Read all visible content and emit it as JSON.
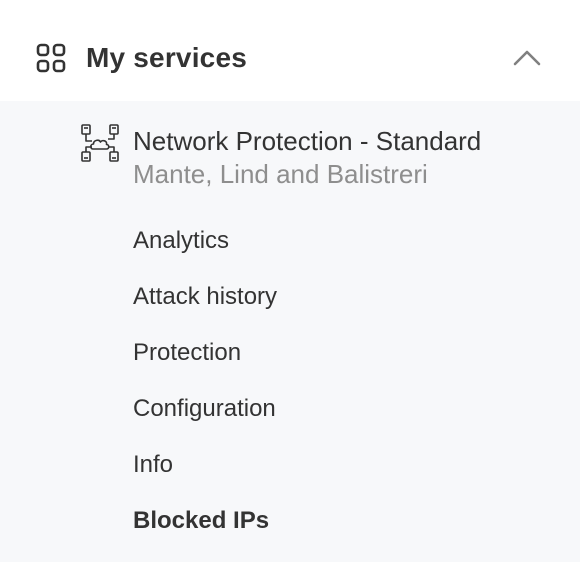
{
  "header": {
    "title": "My services",
    "icon": "grid-icon",
    "toggle_icon": "chevron-up-icon"
  },
  "service": {
    "icon": "network-cloud-icon",
    "name": "Network Protection - Standard",
    "company": "Mante, Lind and Balistreri"
  },
  "menu": {
    "items": [
      {
        "label": "Analytics",
        "active": false
      },
      {
        "label": "Attack history",
        "active": false
      },
      {
        "label": "Protection",
        "active": false
      },
      {
        "label": "Configuration",
        "active": false
      },
      {
        "label": "Info",
        "active": false
      },
      {
        "label": "Blocked IPs",
        "active": true
      }
    ]
  },
  "colors": {
    "text_primary": "#333333",
    "text_secondary": "#8e8e8e",
    "submenu_background": "#f7f8fa",
    "header_background": "#ffffff"
  }
}
